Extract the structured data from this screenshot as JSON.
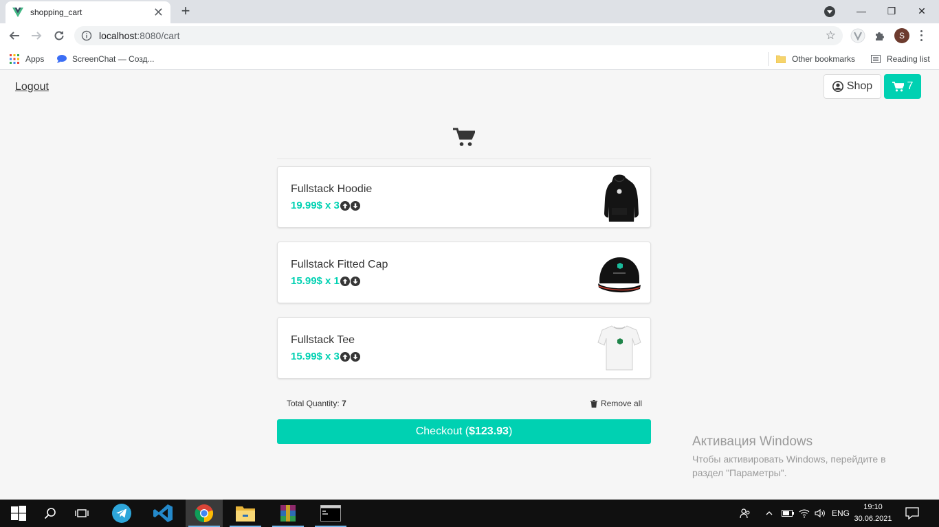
{
  "browser": {
    "tab_title": "shopping_cart",
    "tab_close": "✕",
    "new_tab": "+",
    "url_host": "localhost",
    "url_path": ":8080/cart",
    "bookmarks": {
      "apps": "Apps",
      "screenchat": "ScreenChat — Созд...",
      "other": "Other bookmarks",
      "reading_list": "Reading list"
    },
    "avatar_letter": "S",
    "window_controls": {
      "minimize": "—",
      "restore": "❐",
      "close": "✕"
    }
  },
  "page": {
    "logout": "Logout",
    "shop_label": "Shop",
    "cart_count": "7",
    "items": [
      {
        "name": "Fullstack Hoodie",
        "price": "19.99$ x 3",
        "image": "hoodie-image"
      },
      {
        "name": "Fullstack Fitted Cap",
        "price": "15.99$ x 1",
        "image": "cap-image"
      },
      {
        "name": "Fullstack Tee",
        "price": "15.99$ x 3",
        "image": "tee-image"
      }
    ],
    "total_quantity_label": "Total Quantity:",
    "total_quantity_value": "7",
    "remove_all": "Remove all",
    "checkout_label": "Checkout (",
    "checkout_total": "$123.93",
    "checkout_close": ")"
  },
  "windows_activation": {
    "title": "Активация Windows",
    "text": "Чтобы активировать Windows, перейдите в раздел \"Параметры\"."
  },
  "taskbar": {
    "language": "ENG",
    "time": "19:10",
    "date": "30.06.2021"
  },
  "colors": {
    "accent": "#00d1b2",
    "page_bg": "#f6f6f6",
    "text": "#363636",
    "taskbar": "#101010"
  }
}
